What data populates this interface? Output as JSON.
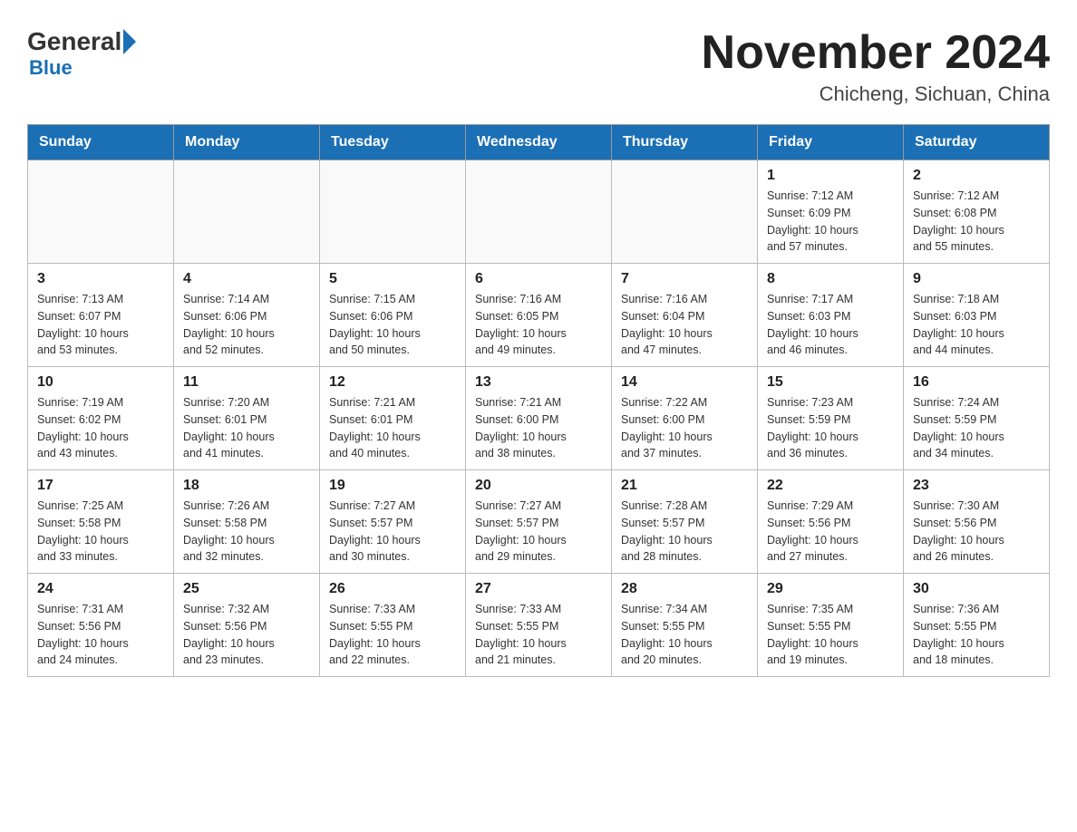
{
  "header": {
    "logo_general": "General",
    "logo_blue": "Blue",
    "month_title": "November 2024",
    "location": "Chicheng, Sichuan, China"
  },
  "weekdays": [
    "Sunday",
    "Monday",
    "Tuesday",
    "Wednesday",
    "Thursday",
    "Friday",
    "Saturday"
  ],
  "weeks": [
    [
      {
        "day": "",
        "info": ""
      },
      {
        "day": "",
        "info": ""
      },
      {
        "day": "",
        "info": ""
      },
      {
        "day": "",
        "info": ""
      },
      {
        "day": "",
        "info": ""
      },
      {
        "day": "1",
        "info": "Sunrise: 7:12 AM\nSunset: 6:09 PM\nDaylight: 10 hours\nand 57 minutes."
      },
      {
        "day": "2",
        "info": "Sunrise: 7:12 AM\nSunset: 6:08 PM\nDaylight: 10 hours\nand 55 minutes."
      }
    ],
    [
      {
        "day": "3",
        "info": "Sunrise: 7:13 AM\nSunset: 6:07 PM\nDaylight: 10 hours\nand 53 minutes."
      },
      {
        "day": "4",
        "info": "Sunrise: 7:14 AM\nSunset: 6:06 PM\nDaylight: 10 hours\nand 52 minutes."
      },
      {
        "day": "5",
        "info": "Sunrise: 7:15 AM\nSunset: 6:06 PM\nDaylight: 10 hours\nand 50 minutes."
      },
      {
        "day": "6",
        "info": "Sunrise: 7:16 AM\nSunset: 6:05 PM\nDaylight: 10 hours\nand 49 minutes."
      },
      {
        "day": "7",
        "info": "Sunrise: 7:16 AM\nSunset: 6:04 PM\nDaylight: 10 hours\nand 47 minutes."
      },
      {
        "day": "8",
        "info": "Sunrise: 7:17 AM\nSunset: 6:03 PM\nDaylight: 10 hours\nand 46 minutes."
      },
      {
        "day": "9",
        "info": "Sunrise: 7:18 AM\nSunset: 6:03 PM\nDaylight: 10 hours\nand 44 minutes."
      }
    ],
    [
      {
        "day": "10",
        "info": "Sunrise: 7:19 AM\nSunset: 6:02 PM\nDaylight: 10 hours\nand 43 minutes."
      },
      {
        "day": "11",
        "info": "Sunrise: 7:20 AM\nSunset: 6:01 PM\nDaylight: 10 hours\nand 41 minutes."
      },
      {
        "day": "12",
        "info": "Sunrise: 7:21 AM\nSunset: 6:01 PM\nDaylight: 10 hours\nand 40 minutes."
      },
      {
        "day": "13",
        "info": "Sunrise: 7:21 AM\nSunset: 6:00 PM\nDaylight: 10 hours\nand 38 minutes."
      },
      {
        "day": "14",
        "info": "Sunrise: 7:22 AM\nSunset: 6:00 PM\nDaylight: 10 hours\nand 37 minutes."
      },
      {
        "day": "15",
        "info": "Sunrise: 7:23 AM\nSunset: 5:59 PM\nDaylight: 10 hours\nand 36 minutes."
      },
      {
        "day": "16",
        "info": "Sunrise: 7:24 AM\nSunset: 5:59 PM\nDaylight: 10 hours\nand 34 minutes."
      }
    ],
    [
      {
        "day": "17",
        "info": "Sunrise: 7:25 AM\nSunset: 5:58 PM\nDaylight: 10 hours\nand 33 minutes."
      },
      {
        "day": "18",
        "info": "Sunrise: 7:26 AM\nSunset: 5:58 PM\nDaylight: 10 hours\nand 32 minutes."
      },
      {
        "day": "19",
        "info": "Sunrise: 7:27 AM\nSunset: 5:57 PM\nDaylight: 10 hours\nand 30 minutes."
      },
      {
        "day": "20",
        "info": "Sunrise: 7:27 AM\nSunset: 5:57 PM\nDaylight: 10 hours\nand 29 minutes."
      },
      {
        "day": "21",
        "info": "Sunrise: 7:28 AM\nSunset: 5:57 PM\nDaylight: 10 hours\nand 28 minutes."
      },
      {
        "day": "22",
        "info": "Sunrise: 7:29 AM\nSunset: 5:56 PM\nDaylight: 10 hours\nand 27 minutes."
      },
      {
        "day": "23",
        "info": "Sunrise: 7:30 AM\nSunset: 5:56 PM\nDaylight: 10 hours\nand 26 minutes."
      }
    ],
    [
      {
        "day": "24",
        "info": "Sunrise: 7:31 AM\nSunset: 5:56 PM\nDaylight: 10 hours\nand 24 minutes."
      },
      {
        "day": "25",
        "info": "Sunrise: 7:32 AM\nSunset: 5:56 PM\nDaylight: 10 hours\nand 23 minutes."
      },
      {
        "day": "26",
        "info": "Sunrise: 7:33 AM\nSunset: 5:55 PM\nDaylight: 10 hours\nand 22 minutes."
      },
      {
        "day": "27",
        "info": "Sunrise: 7:33 AM\nSunset: 5:55 PM\nDaylight: 10 hours\nand 21 minutes."
      },
      {
        "day": "28",
        "info": "Sunrise: 7:34 AM\nSunset: 5:55 PM\nDaylight: 10 hours\nand 20 minutes."
      },
      {
        "day": "29",
        "info": "Sunrise: 7:35 AM\nSunset: 5:55 PM\nDaylight: 10 hours\nand 19 minutes."
      },
      {
        "day": "30",
        "info": "Sunrise: 7:36 AM\nSunset: 5:55 PM\nDaylight: 10 hours\nand 18 minutes."
      }
    ]
  ]
}
